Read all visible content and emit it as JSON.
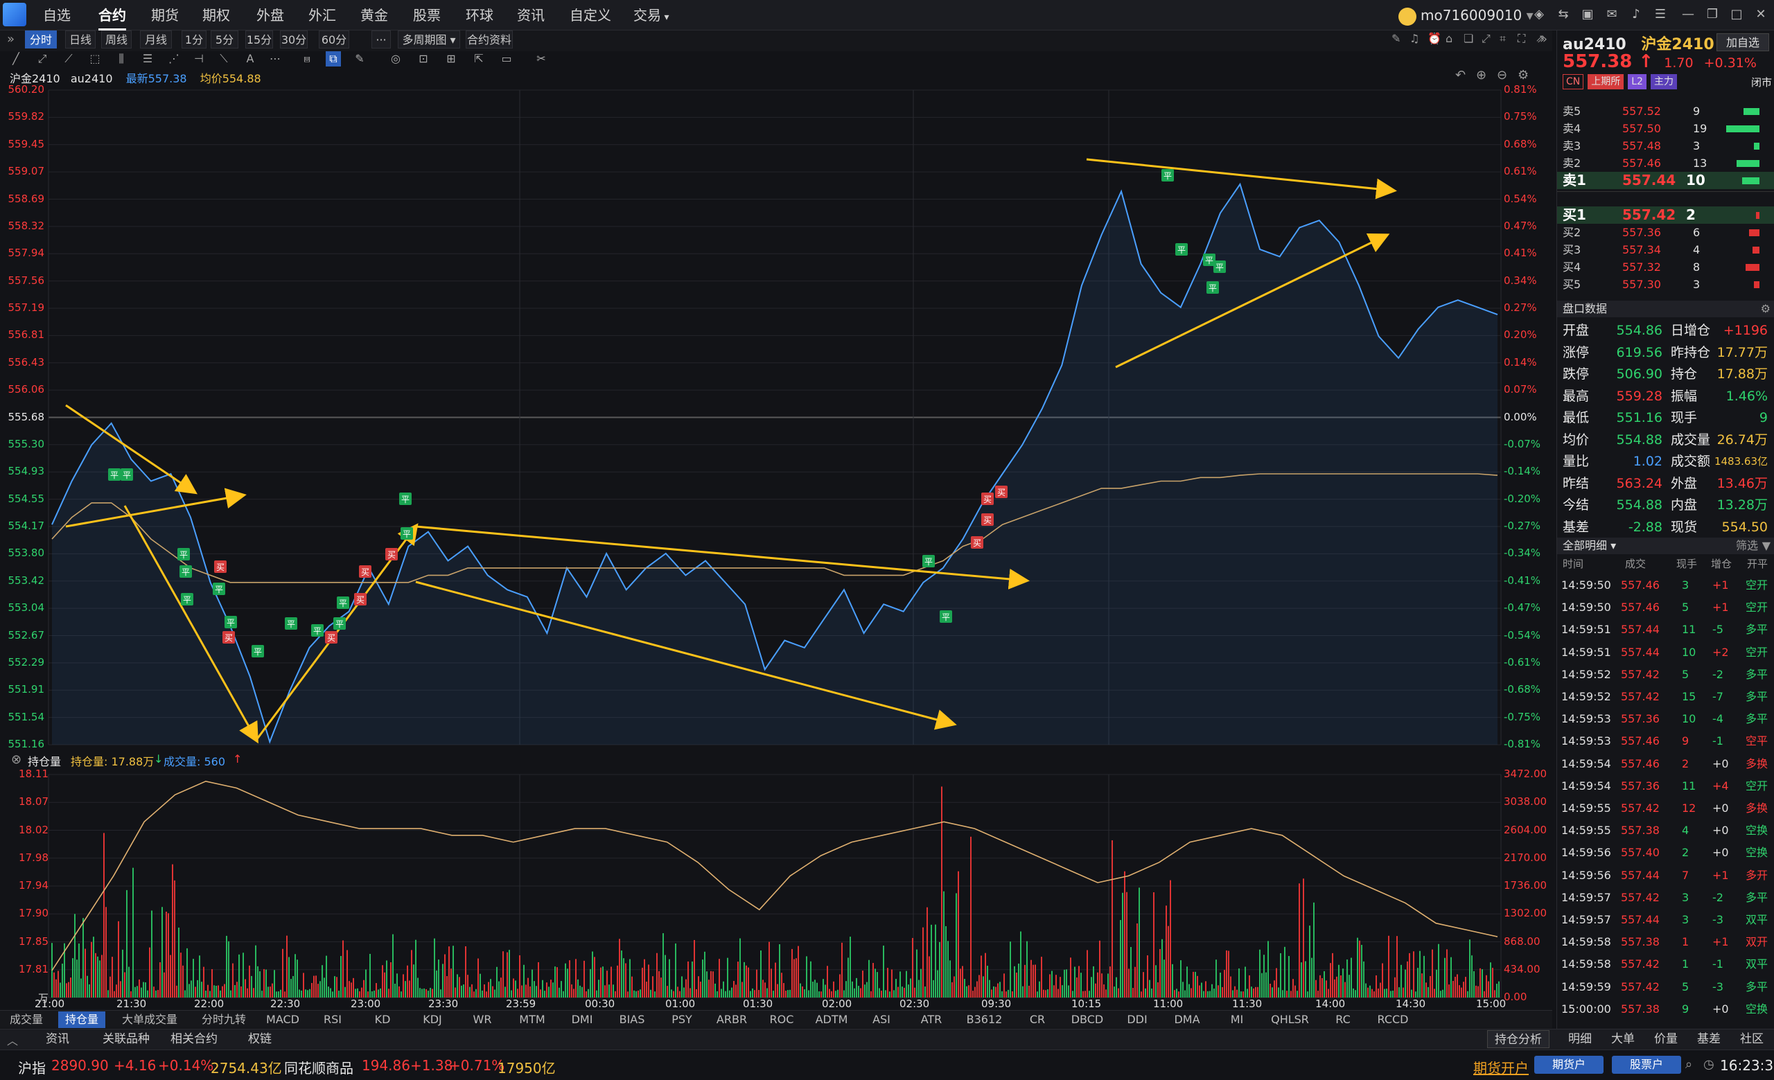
{
  "menu": [
    "自选",
    "合约",
    "期货",
    "期权",
    "外盘",
    "外汇",
    "黄金",
    "股票",
    "环球",
    "资讯",
    "自定义",
    "交易"
  ],
  "active_menu": "合约",
  "user": {
    "name": "mo716009010"
  },
  "periods": [
    "分时",
    "日线",
    "周线",
    "月线",
    "1分",
    "5分",
    "15分",
    "30分",
    "60分",
    "多周期图",
    "合约资料"
  ],
  "selected_period": "分时",
  "legend": {
    "name": "沪金2410",
    "code": "au2410",
    "latest": "最新557.38",
    "avg": "均价554.88"
  },
  "price_axis": [
    "560.20",
    "559.82",
    "559.45",
    "559.07",
    "558.69",
    "558.32",
    "557.94",
    "557.56",
    "557.19",
    "556.81",
    "556.43",
    "556.06",
    "555.68",
    "555.30",
    "554.93",
    "554.55",
    "554.17",
    "553.80",
    "553.42",
    "553.04",
    "552.67",
    "552.29",
    "551.91",
    "551.54",
    "551.16"
  ],
  "pct_axis": [
    "0.81%",
    "0.75%",
    "0.68%",
    "0.61%",
    "0.54%",
    "0.47%",
    "0.41%",
    "0.34%",
    "0.27%",
    "0.20%",
    "0.14%",
    "0.07%",
    "0.00%",
    "-0.07%",
    "-0.14%",
    "-0.20%",
    "-0.27%",
    "-0.34%",
    "-0.41%",
    "-0.47%",
    "-0.54%",
    "-0.61%",
    "-0.68%",
    "-0.75%",
    "-0.81%"
  ],
  "time_axis": [
    "21:00",
    "21:30",
    "22:00",
    "22:30",
    "23:00",
    "23:30",
    "23:59",
    "00:30",
    "01:00",
    "01:30",
    "02:00",
    "02:30",
    "09:30",
    "10:15",
    "11:00",
    "11:30",
    "14:00",
    "14:30",
    "15:00"
  ],
  "sub_header": {
    "title": "持仓量",
    "oi_label": "持仓量: 17.88万",
    "oi_arrow": "↓",
    "vol_label": "成交量: 560",
    "vol_arrow": "↑"
  },
  "oi_axis": [
    "18.11",
    "18.07",
    "18.02",
    "17.98",
    "17.94",
    "17.90",
    "17.85",
    "17.81",
    "万"
  ],
  "vol_axis": [
    "3472.00",
    "3038.00",
    "2604.00",
    "2170.00",
    "1736.00",
    "1302.00",
    "868.00",
    "434.00",
    "0.00"
  ],
  "indicator_tabs": [
    "成交量",
    "持仓量",
    "大单成交量",
    "分时九转",
    "MACD",
    "RSI",
    "KD",
    "KDJ",
    "WR",
    "MTM",
    "DMI",
    "BIAS",
    "PSY",
    "ARBR",
    "ROC",
    "ADTM",
    "ASI",
    "ATR",
    "B3612",
    "CR",
    "DBCD",
    "DDI",
    "DMA",
    "MI",
    "QHLSR",
    "RC",
    "RCCD"
  ],
  "selected_indicator": "持仓量",
  "bottom_tabs": [
    "资讯",
    "关联品种",
    "相关合约",
    "权链"
  ],
  "bottom_right": "持仓分析",
  "right_tabs": [
    "明细",
    "大单",
    "价量",
    "基差",
    "社区"
  ],
  "contract": {
    "code": "au2410",
    "name": "沪金2410",
    "add": "加自选",
    "price": "557.38",
    "arrow": "↑",
    "change": "1.70",
    "pct": "+0.31%",
    "tags": [
      "CN",
      "上期所",
      "L2",
      "主力"
    ],
    "status": "闭市"
  },
  "asks": [
    {
      "label": "卖5",
      "price": "557.52",
      "vol": "9"
    },
    {
      "label": "卖4",
      "price": "557.50",
      "vol": "19"
    },
    {
      "label": "卖3",
      "price": "557.48",
      "vol": "3"
    },
    {
      "label": "卖2",
      "price": "557.46",
      "vol": "13"
    },
    {
      "label": "卖1",
      "price": "557.44",
      "vol": "10"
    }
  ],
  "bids": [
    {
      "label": "买1",
      "price": "557.42",
      "vol": "2"
    },
    {
      "label": "买2",
      "price": "557.36",
      "vol": "6"
    },
    {
      "label": "买3",
      "price": "557.34",
      "vol": "4"
    },
    {
      "label": "买4",
      "price": "557.32",
      "vol": "8"
    },
    {
      "label": "买5",
      "price": "557.30",
      "vol": "3"
    }
  ],
  "panel_title": "盘口数据",
  "stats": [
    [
      "开盘",
      "554.86",
      "日增仓",
      "+1196"
    ],
    [
      "涨停",
      "619.56",
      "昨持仓",
      "17.77万"
    ],
    [
      "跌停",
      "506.90",
      "持仓",
      "17.88万"
    ],
    [
      "最高",
      "559.28",
      "振幅",
      "1.46%"
    ],
    [
      "最低",
      "551.16",
      "现手",
      "9"
    ],
    [
      "均价",
      "554.88",
      "成交量",
      "26.74万"
    ],
    [
      "量比",
      "1.02",
      "成交额",
      "1483.63亿"
    ],
    [
      "昨结",
      "563.24",
      "外盘",
      "13.46万"
    ],
    [
      "今结",
      "554.88",
      "内盘",
      "13.28万"
    ],
    [
      "基差",
      "-2.88",
      "现货",
      "554.50"
    ]
  ],
  "detail_title": "全部明细",
  "filter": "筛选",
  "detail_headers": [
    "时间",
    "成交",
    "现手",
    "增仓",
    "开平"
  ],
  "trades": [
    [
      "14:59:50",
      "557.46",
      "3",
      "+1",
      "空开"
    ],
    [
      "14:59:50",
      "557.46",
      "5",
      "+1",
      "空开"
    ],
    [
      "14:59:51",
      "557.44",
      "11",
      "-5",
      "多平"
    ],
    [
      "14:59:51",
      "557.44",
      "10",
      "+2",
      "空开"
    ],
    [
      "14:59:52",
      "557.42",
      "5",
      "-2",
      "多平"
    ],
    [
      "14:59:52",
      "557.42",
      "15",
      "-7",
      "多平"
    ],
    [
      "14:59:53",
      "557.36",
      "10",
      "-4",
      "多平"
    ],
    [
      "14:59:53",
      "557.46",
      "9",
      "-1",
      "空平"
    ],
    [
      "14:59:54",
      "557.46",
      "2",
      "+0",
      "多换"
    ],
    [
      "14:59:54",
      "557.36",
      "11",
      "+4",
      "空开"
    ],
    [
      "14:59:55",
      "557.42",
      "12",
      "+0",
      "多换"
    ],
    [
      "14:59:55",
      "557.38",
      "4",
      "+0",
      "空换"
    ],
    [
      "14:59:56",
      "557.40",
      "2",
      "+0",
      "空换"
    ],
    [
      "14:59:56",
      "557.44",
      "7",
      "+1",
      "多开"
    ],
    [
      "14:59:57",
      "557.42",
      "3",
      "-2",
      "多平"
    ],
    [
      "14:59:57",
      "557.44",
      "3",
      "-3",
      "双平"
    ],
    [
      "14:59:58",
      "557.38",
      "1",
      "+1",
      "双开"
    ],
    [
      "14:59:58",
      "557.42",
      "1",
      "-1",
      "双平"
    ],
    [
      "14:59:59",
      "557.42",
      "5",
      "-3",
      "多平"
    ],
    [
      "15:00:00",
      "557.38",
      "9",
      "+0",
      "空换"
    ]
  ],
  "status_bar": {
    "idx1_name": "沪指",
    "idx1_val": "2890.90",
    "idx1_chg": "+4.16",
    "idx1_pct": "+0.14%",
    "idx1_amt": "2754.43亿",
    "idx2_name": "同花顺商品",
    "idx2_val": "194.86",
    "idx2_chg": "+1.38",
    "idx2_pct": "+0.71%",
    "idx2_amt": "17950亿",
    "open_acct": "期货开户",
    "btn1": "期货户",
    "btn2": "股票户",
    "time": "16:23:38"
  },
  "colors": {
    "up": "#ff3b3b",
    "down": "#2fd36d",
    "line": "#4a9fff",
    "avg": "#c9a36a",
    "arrow": "#ffc21a"
  },
  "chart_data": {
    "type": "line",
    "ylim": [
      551.16,
      560.2
    ],
    "prev_settle_line": 555.68,
    "price_series": [
      554.2,
      554.8,
      555.3,
      555.6,
      555.1,
      554.8,
      554.9,
      554.3,
      553.4,
      552.8,
      552.1,
      551.2,
      551.9,
      552.5,
      552.8,
      553.0,
      553.6,
      553.1,
      553.9,
      554.1,
      553.7,
      553.9,
      553.5,
      553.3,
      553.2,
      552.7,
      553.6,
      553.2,
      553.8,
      553.3,
      553.6,
      553.8,
      553.5,
      553.7,
      553.4,
      553.1,
      552.2,
      552.6,
      552.5,
      552.9,
      553.3,
      552.7,
      553.1,
      553.0,
      553.4,
      553.6,
      554.0,
      554.5,
      554.9,
      555.3,
      555.8,
      556.4,
      557.5,
      558.2,
      558.8,
      557.8,
      557.4,
      557.2,
      557.8,
      558.5,
      558.9,
      558.0,
      557.9,
      558.3,
      558.4,
      558.1,
      557.5,
      556.8,
      556.5,
      556.9,
      557.2,
      557.3,
      557.2,
      557.1
    ],
    "avg_series": [
      554.0,
      554.3,
      554.5,
      554.5,
      554.3,
      554.0,
      553.8,
      553.6,
      553.5,
      553.4,
      553.4,
      553.4,
      553.4,
      553.4,
      553.4,
      553.4,
      553.4,
      553.4,
      553.4,
      553.5,
      553.5,
      553.6,
      553.6,
      553.6,
      553.6,
      553.6,
      553.6,
      553.6,
      553.6,
      553.6,
      553.6,
      553.6,
      553.6,
      553.6,
      553.6,
      553.6,
      553.6,
      553.6,
      553.6,
      553.6,
      553.5,
      553.5,
      553.5,
      553.5,
      553.6,
      553.7,
      553.9,
      554.0,
      554.2,
      554.3,
      554.4,
      554.5,
      554.6,
      554.7,
      554.7,
      554.75,
      554.8,
      554.8,
      554.85,
      554.85,
      554.88,
      554.9,
      554.9,
      554.9,
      554.9,
      554.9,
      554.9,
      554.9,
      554.9,
      554.9,
      554.9,
      554.9,
      554.9,
      554.88
    ],
    "oi_series": [
      17.83,
      17.9,
      17.97,
      18.05,
      18.09,
      18.11,
      18.1,
      18.08,
      18.06,
      18.05,
      18.04,
      18.04,
      18.04,
      18.03,
      18.03,
      18.02,
      18.03,
      18.04,
      18.04,
      18.03,
      18.02,
      17.99,
      17.95,
      17.92,
      17.97,
      18.0,
      18.02,
      18.03,
      18.04,
      18.05,
      18.04,
      18.02,
      18.0,
      17.98,
      17.96,
      17.97,
      17.99,
      18.02,
      18.03,
      18.04,
      18.03,
      18.0,
      17.97,
      17.95,
      17.93,
      17.9,
      17.89,
      17.88
    ],
    "xlabels": [
      "21:00",
      "21:30",
      "22:00",
      "22:30",
      "23:00",
      "23:30",
      "23:59",
      "00:30",
      "01:00",
      "01:30",
      "02:00",
      "02:30",
      "09:30",
      "10:15",
      "11:00",
      "11:30",
      "14:00",
      "14:30",
      "15:00"
    ]
  }
}
